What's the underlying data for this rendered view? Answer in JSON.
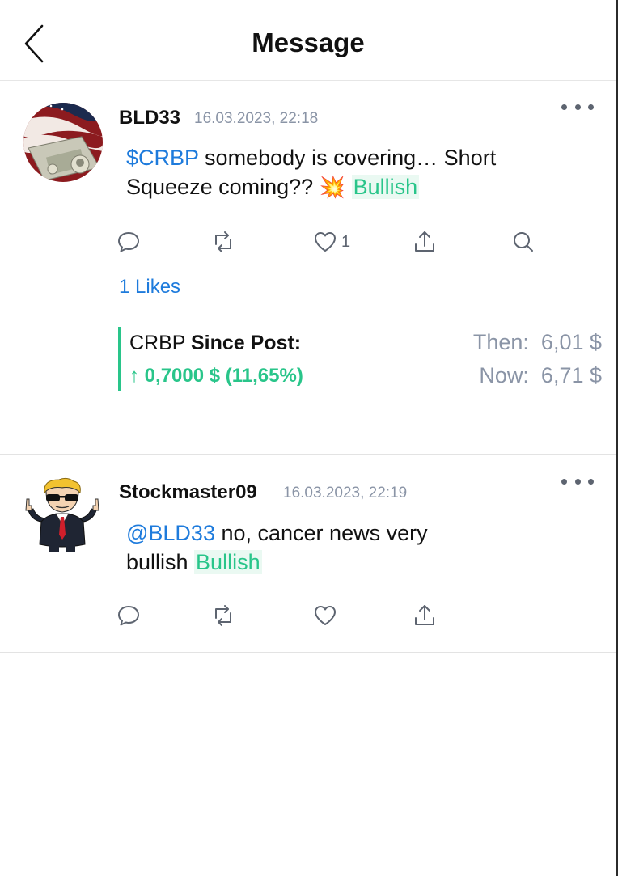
{
  "header": {
    "title": "Message",
    "back_icon": "chevron-left-icon"
  },
  "posts": [
    {
      "username": "BLD33",
      "timestamp": "16.03.2023, 22:18",
      "cashtag": "$CRBP",
      "text_a": " somebody is covering… Short",
      "text_b": "Squeeze coming?? ",
      "emoji": "💥",
      "sentiment": "Bullish",
      "like_count": "1",
      "likes_label": "1 Likes",
      "since_post": {
        "symbol": "CRBP",
        "label": "Since Post:",
        "arrow": "↑",
        "change": "0,7000 $  (11,65%)",
        "then_label": "Then:",
        "then_value": "6,01 $",
        "now_label": "Now:",
        "now_value": "6,71 $"
      }
    },
    {
      "username": "Stockmaster09",
      "timestamp": "16.03.2023, 22:19",
      "mention": "@BLD33",
      "text_a": " no, cancer news very",
      "text_b": "bullish ",
      "sentiment": "Bullish"
    }
  ],
  "colors": {
    "accent_blue": "#1e7bdc",
    "bullish_green": "#29c58a",
    "muted": "#8a94a6",
    "icon_gray": "#5d6470"
  }
}
